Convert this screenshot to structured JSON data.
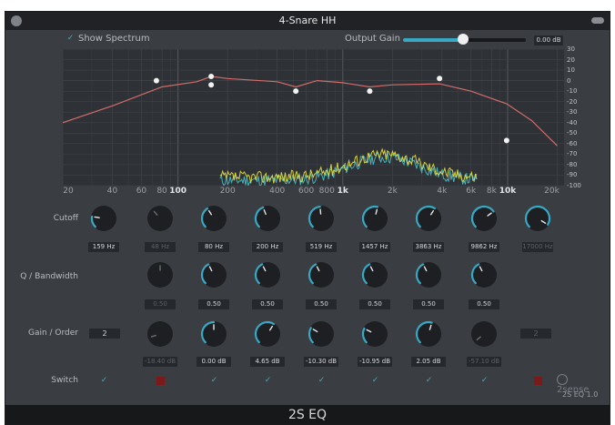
{
  "window": {
    "title": "4-Snare HH"
  },
  "spectrum": {
    "checked": true,
    "label": "Show Spectrum"
  },
  "output_gain": {
    "label": "Output Gain",
    "value": "0.00 dB",
    "level": 0.49
  },
  "plot": {
    "y_ticks": [
      "30",
      "20",
      "10",
      "0",
      "-10",
      "-20",
      "-30",
      "-40",
      "-50",
      "-60",
      "-70",
      "-80",
      "-90",
      "-100"
    ],
    "x_ticks": [
      {
        "label": "20",
        "freq": 20,
        "bold": false
      },
      {
        "label": "40",
        "freq": 40,
        "bold": false
      },
      {
        "label": "60",
        "freq": 60,
        "bold": false
      },
      {
        "label": "80",
        "freq": 80,
        "bold": false
      },
      {
        "label": "100",
        "freq": 100,
        "bold": true
      },
      {
        "label": "200",
        "freq": 200,
        "bold": false
      },
      {
        "label": "400",
        "freq": 400,
        "bold": false
      },
      {
        "label": "600",
        "freq": 600,
        "bold": false
      },
      {
        "label": "800",
        "freq": 800,
        "bold": false
      },
      {
        "label": "1k",
        "freq": 1000,
        "bold": true
      },
      {
        "label": "2k",
        "freq": 2000,
        "bold": false
      },
      {
        "label": "4k",
        "freq": 4000,
        "bold": false
      },
      {
        "label": "6k",
        "freq": 6000,
        "bold": false
      },
      {
        "label": "8k",
        "freq": 8000,
        "bold": false
      },
      {
        "label": "10k",
        "freq": 10000,
        "bold": true
      },
      {
        "label": "20k",
        "freq": 20000,
        "bold": false
      }
    ],
    "curve": [
      [
        20,
        -40
      ],
      [
        40,
        -24
      ],
      [
        80,
        -6
      ],
      [
        130,
        -1
      ],
      [
        159,
        4
      ],
      [
        200,
        2
      ],
      [
        400,
        -1
      ],
      [
        519,
        -6
      ],
      [
        700,
        0
      ],
      [
        1000,
        -2
      ],
      [
        1457,
        -6
      ],
      [
        2000,
        -4
      ],
      [
        3863,
        -3
      ],
      [
        6000,
        -10
      ],
      [
        9862,
        -22
      ],
      [
        14000,
        -38
      ],
      [
        20000,
        -62
      ]
    ],
    "nodes": [
      [
        74,
        0
      ],
      [
        159,
        -4
      ],
      [
        159,
        4
      ],
      [
        519,
        -10
      ],
      [
        1457,
        -10
      ],
      [
        3863,
        2
      ],
      [
        9862,
        -57
      ]
    ]
  },
  "rows": {
    "cutoff": "Cutoff",
    "q": "Q / Bandwidth",
    "gain": "Gain / Order",
    "switch": "Switch"
  },
  "bands": [
    {
      "cutoff": "159 Hz",
      "cutoff_on": true,
      "cutoff_level": 0.2,
      "q": "",
      "q_show": false,
      "gain": "",
      "gain_show": false,
      "switch": "on"
    },
    {
      "cutoff": "48 Hz",
      "cutoff_on": false,
      "cutoff_level": 0.35,
      "q": "0.50",
      "q_on": false,
      "q_show": true,
      "q_level": 0.5,
      "gain": "-18.40 dB",
      "gain_on": false,
      "gain_level": 0.1,
      "gain_show": true,
      "switch": "off"
    },
    {
      "cutoff": "80 Hz",
      "cutoff_on": true,
      "cutoff_level": 0.38,
      "q": "0.50",
      "q_on": true,
      "q_show": true,
      "q_level": 0.4,
      "gain": "0.00 dB",
      "gain_on": true,
      "gain_level": 0.5,
      "gain_show": true,
      "switch": "on"
    },
    {
      "cutoff": "200 Hz",
      "cutoff_on": true,
      "cutoff_level": 0.42,
      "q": "0.50",
      "q_on": true,
      "q_show": true,
      "q_level": 0.4,
      "gain": "4.65 dB",
      "gain_on": true,
      "gain_level": 0.62,
      "gain_show": true,
      "switch": "on"
    },
    {
      "cutoff": "519 Hz",
      "cutoff_on": true,
      "cutoff_level": 0.48,
      "q": "0.50",
      "q_on": true,
      "q_show": true,
      "q_level": 0.4,
      "gain": "-10.30 dB",
      "gain_on": true,
      "gain_level": 0.28,
      "gain_show": true,
      "switch": "on"
    },
    {
      "cutoff": "1457 Hz",
      "cutoff_on": true,
      "cutoff_level": 0.55,
      "q": "0.50",
      "q_on": true,
      "q_show": true,
      "q_level": 0.4,
      "gain": "-10.95 dB",
      "gain_on": true,
      "gain_level": 0.27,
      "gain_show": true,
      "switch": "on"
    },
    {
      "cutoff": "3863 Hz",
      "cutoff_on": true,
      "cutoff_level": 0.62,
      "q": "0.50",
      "q_on": true,
      "q_show": true,
      "q_level": 0.4,
      "gain": "2.05 dB",
      "gain_on": true,
      "gain_level": 0.56,
      "gain_show": true,
      "switch": "on"
    },
    {
      "cutoff": "9862 Hz",
      "cutoff_on": true,
      "cutoff_level": 0.7,
      "q": "0.50",
      "q_on": true,
      "q_show": true,
      "q_level": 0.4,
      "gain": "-57.10 dB",
      "gain_on": false,
      "gain_level": 0.02,
      "gain_show": true,
      "switch": "on"
    },
    {
      "cutoff": "17000 Hz",
      "cutoff_on": true,
      "cutoff_level": 0.95,
      "cutoff_dim": true,
      "q": "",
      "q_show": false,
      "gain": "",
      "gain_show": false,
      "switch": "off"
    }
  ],
  "order_left": "2",
  "order_right": "2",
  "logo_text": "2sense",
  "version": "2S EQ 1.0",
  "footer": "2S EQ",
  "colors": {
    "accent": "#38a9c4",
    "curve": "#d26c6c",
    "spec_yellow": "#e7e243",
    "spec_cyan": "#4bc0c8"
  }
}
